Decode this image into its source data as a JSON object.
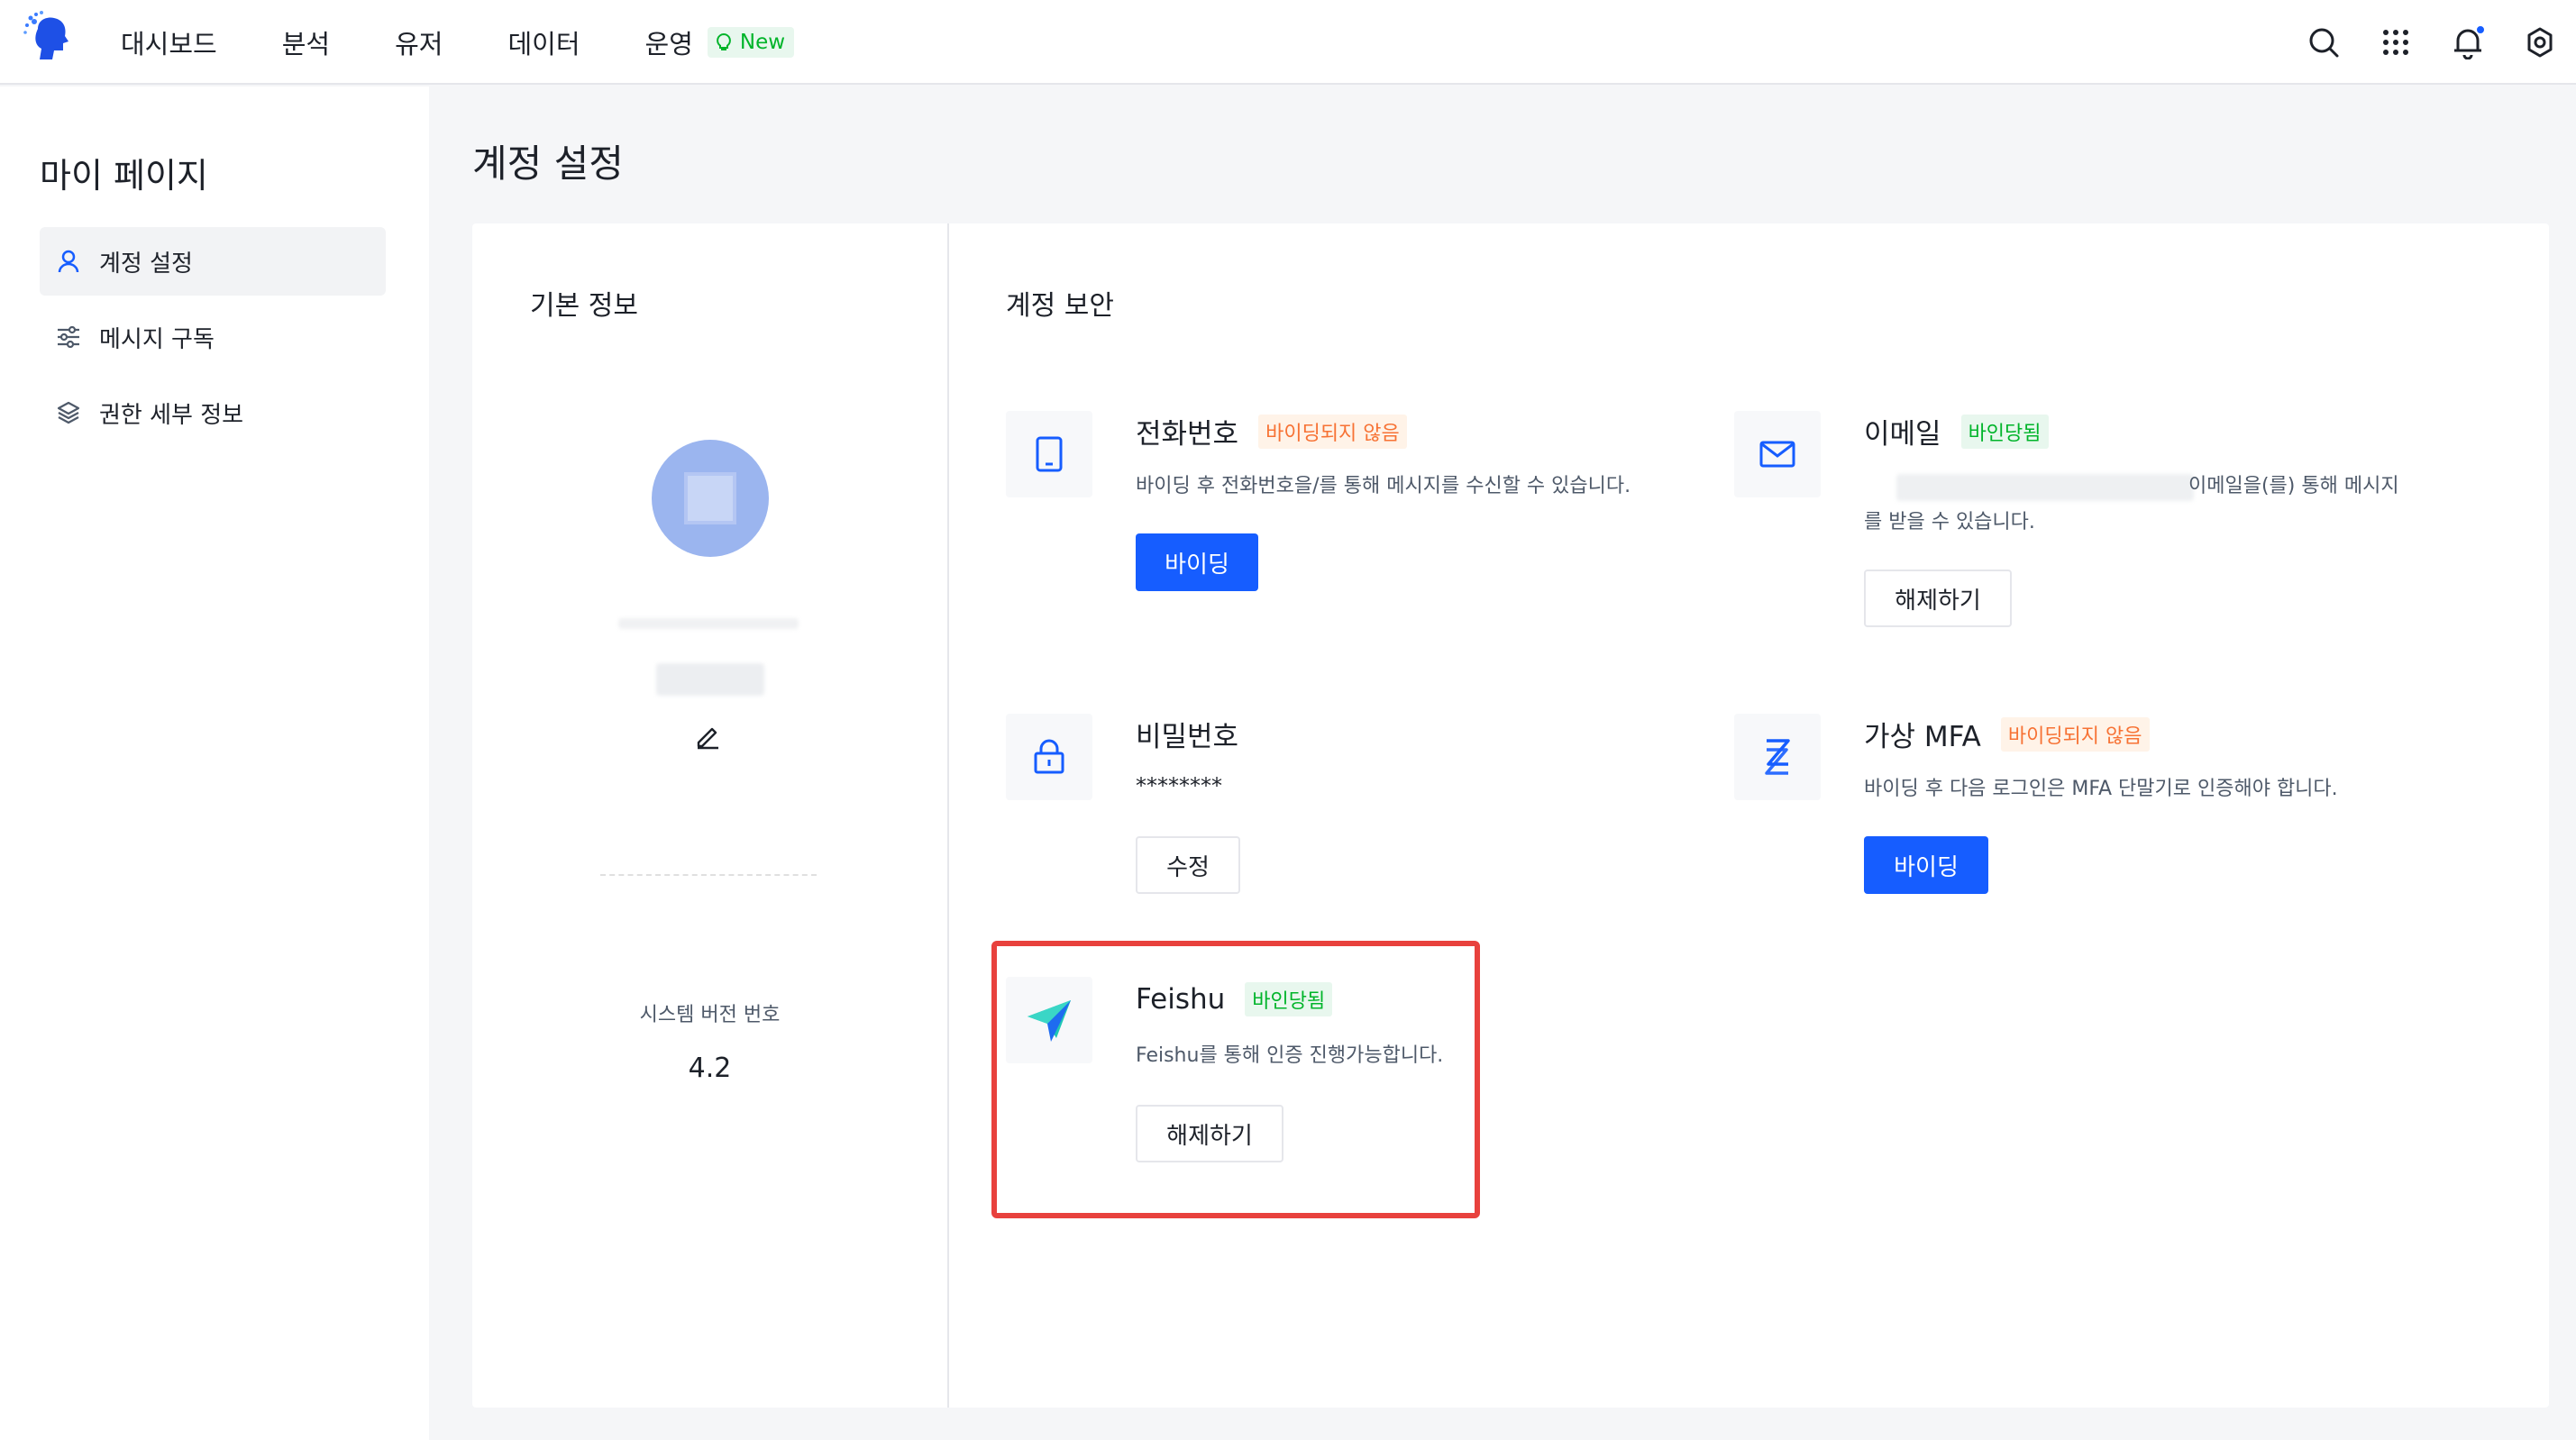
{
  "nav": {
    "items": [
      {
        "label": "대시보드"
      },
      {
        "label": "분석"
      },
      {
        "label": "유저"
      },
      {
        "label": "데이터"
      },
      {
        "label": "운영",
        "badge": "New"
      }
    ]
  },
  "sidebar": {
    "title": "마이 페이지",
    "items": [
      {
        "label": "계정 설정",
        "icon": "user-icon",
        "active": true
      },
      {
        "label": "메시지 구독",
        "icon": "sliders-icon"
      },
      {
        "label": "권한 세부 정보",
        "icon": "layers-icon"
      }
    ]
  },
  "page": {
    "title": "계정 설정"
  },
  "basic": {
    "title": "기본 정보",
    "version_label": "시스템 버전 번호",
    "version_value": "4.2"
  },
  "security": {
    "title": "계정 보안",
    "phone": {
      "name": "전화번호",
      "tag": "바이딩되지 않음",
      "desc": "바이딩 후 전화번호을/를 통해 메시지를 수신할 수 있습니다.",
      "button": "바이딩"
    },
    "email": {
      "name": "이메일",
      "tag": "바인당됨",
      "desc_tail": "이메일을(를) 통해 메시지",
      "desc_line2": "를 받을 수 있습니다.",
      "button": "해제하기"
    },
    "password": {
      "name": "비밀번호",
      "value": "********",
      "button": "수정"
    },
    "mfa": {
      "name": "가상 MFA",
      "tag": "바이딩되지 않음",
      "desc": "바이딩 후 다음 로그인은 MFA 단말기로 인증해야 합니다.",
      "button": "바이딩"
    },
    "feishu": {
      "name": "Feishu",
      "tag": "바인당됨",
      "desc": "Feishu를 통해 인증 진행가능합니다.",
      "button": "해제하기"
    }
  },
  "colors": {
    "primary": "#165dff",
    "success": "#00b42a",
    "warning": "#f77234",
    "highlight": "#e8413d"
  }
}
